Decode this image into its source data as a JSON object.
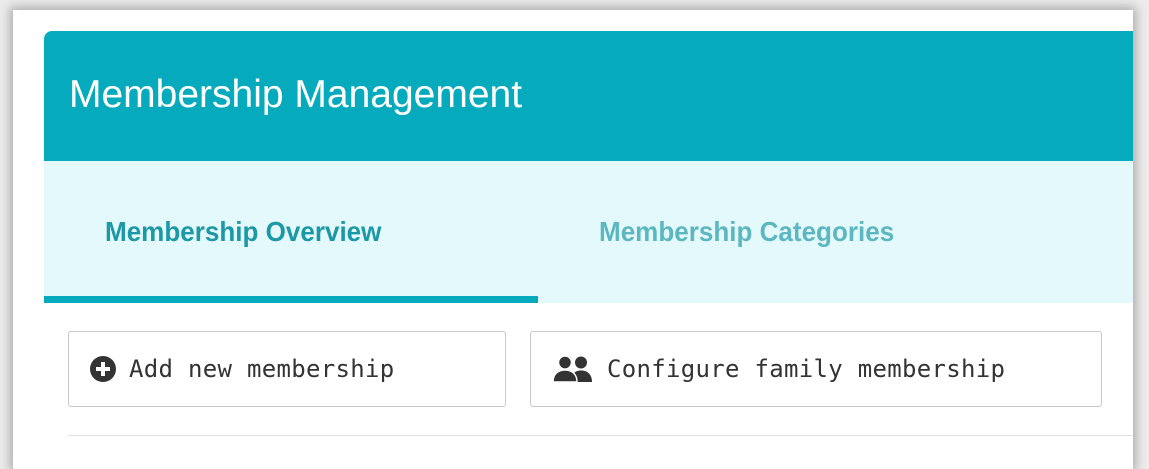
{
  "header": {
    "title": "Membership Management"
  },
  "tabs": [
    {
      "label": "Membership Overview",
      "active": true
    },
    {
      "label": "Membership Categories",
      "active": false
    }
  ],
  "toolbar": {
    "add_label": "Add new membership",
    "add_icon": "plus-circle-icon",
    "family_label": "Configure family membership",
    "family_icon": "users-icon"
  },
  "colors": {
    "header_bg": "#06aabd",
    "tabs_bg": "#e4f9fc",
    "active_tab_text": "#1d98a6",
    "inactive_tab_text": "#5cb7c1",
    "underline": "#06aabd"
  }
}
